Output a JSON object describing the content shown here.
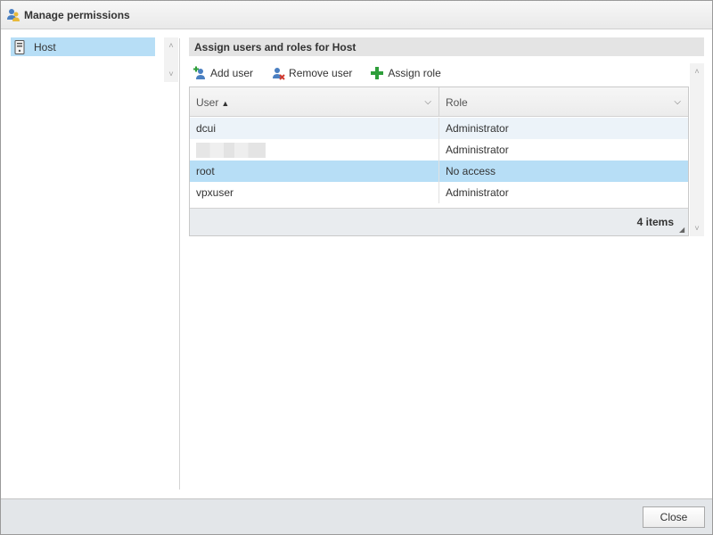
{
  "window": {
    "title": "Manage permissions",
    "title_icon": "users-icon"
  },
  "tree": {
    "items": [
      {
        "label": "Host",
        "icon": "host-icon",
        "selected": true
      }
    ]
  },
  "section": {
    "title": "Assign users and roles for Host"
  },
  "toolbar": {
    "add_user": "Add user",
    "remove_user": "Remove user",
    "assign_role": "Assign role"
  },
  "grid": {
    "columns": [
      {
        "label": "User",
        "sort": "ascending"
      },
      {
        "label": "Role"
      }
    ],
    "rows": [
      {
        "user": "dcui",
        "role": "Administrator"
      },
      {
        "user": "",
        "user_redacted": true,
        "role": "Administrator"
      },
      {
        "user": "root",
        "role": "No access",
        "selected": true
      },
      {
        "user": "vpxuser",
        "role": "Administrator"
      }
    ],
    "footer_count": "4 items"
  },
  "buttons": {
    "close": "Close"
  },
  "colors": {
    "selection": "#b7def6",
    "header_bg": "#e4e4e4",
    "footer_bg": "#e3e6e9"
  }
}
